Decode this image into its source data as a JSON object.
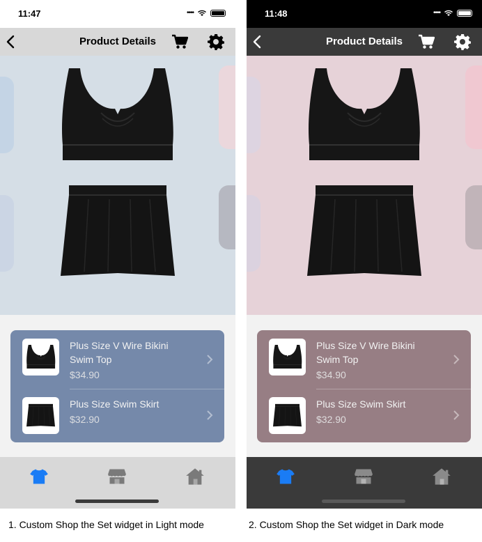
{
  "screens": [
    {
      "mode": "light",
      "status": {
        "time": "11:47"
      },
      "nav": {
        "title": "Product Details"
      },
      "colors": {
        "status_bg": "#ffffff",
        "status_fg": "#000000",
        "nav_bg": "#d8d8d8",
        "nav_fg": "#000000",
        "hero_bg": "#d5dee6",
        "below_bg": "#f2f2f2",
        "card_bg": "#7589aa",
        "tab_bg": "#d8d8d8",
        "tab_active": "#1a7cf5",
        "tab_inactive": "#7a7a7a",
        "home_indicator": "#3a3a3a"
      },
      "products": [
        {
          "name": "Plus Size V Wire Bikini Swim Top",
          "price": "$34.90"
        },
        {
          "name": "Plus Size Swim Skirt",
          "price": "$32.90"
        }
      ],
      "caption": "1. Custom Shop the Set widget in Light mode"
    },
    {
      "mode": "dark",
      "status": {
        "time": "11:48"
      },
      "nav": {
        "title": "Product Details"
      },
      "colors": {
        "status_bg": "#000000",
        "status_fg": "#ffffff",
        "nav_bg": "#3a3a3a",
        "nav_fg": "#ffffff",
        "hero_bg": "#e6d2d8",
        "below_bg": "#f2f2f2",
        "card_bg": "#977e84",
        "tab_bg": "#3a3a3a",
        "tab_active": "#1a7cf5",
        "tab_inactive": "#8a8a8a",
        "home_indicator": "#5a5a5a"
      },
      "products": [
        {
          "name": "Plus Size V Wire Bikini Swim Top",
          "price": "$34.90"
        },
        {
          "name": "Plus Size Swim Skirt",
          "price": "$32.90"
        }
      ],
      "caption": "2. Custom Shop the Set widget in Dark mode"
    }
  ],
  "tabs": [
    {
      "icon": "tshirt-icon",
      "active": true
    },
    {
      "icon": "store-icon",
      "active": false
    },
    {
      "icon": "home-icon",
      "active": false
    }
  ]
}
